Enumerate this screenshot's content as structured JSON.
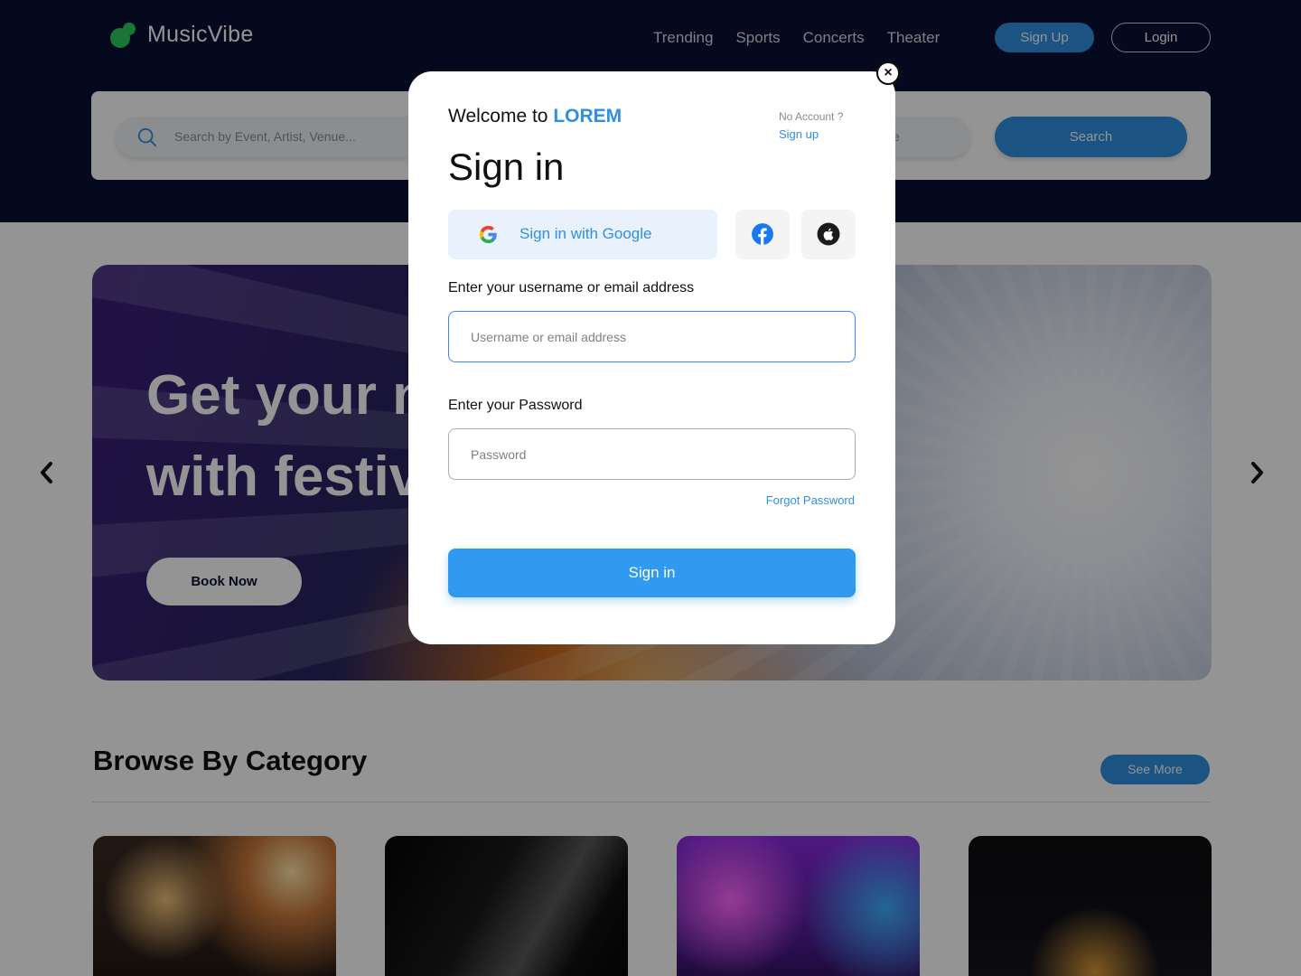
{
  "app": {
    "name": "MusicVibe",
    "nav": [
      "Trending",
      "Sports",
      "Concerts",
      "Theater"
    ],
    "signup_label": "Sign Up",
    "login_label": "Login"
  },
  "search": {
    "placeholder": "Search by Event,  Artist, Venue...",
    "date_placeholder": "ite",
    "button_label": "Search"
  },
  "hero": {
    "title": "Get your n\nwith festiv",
    "button_label": "Book Now"
  },
  "category": {
    "title": "Browse By Category",
    "see_more_label": "See More"
  },
  "modal": {
    "welcome_prefix": "Welcome to ",
    "brand": "LOREM",
    "no_account": "No Account ?",
    "signup_link": "Sign up",
    "title": "Sign in",
    "google_label": "Sign in with Google",
    "username_label": "Enter your username or email address",
    "username_placeholder": "Username or email address",
    "password_label": "Enter your Password",
    "password_placeholder": "Password",
    "forgot_label": "Forgot Password",
    "submit_label": "Sign in",
    "close_symbol": "×"
  },
  "colors": {
    "header_bg": "#0a1033",
    "accent": "#2f8fe0",
    "logo_green": "#2ccb5a"
  },
  "icons": [
    "music-logo-icon",
    "search-icon",
    "google-icon",
    "facebook-icon",
    "apple-icon",
    "close-icon",
    "chevron-left-icon",
    "chevron-right-icon"
  ]
}
